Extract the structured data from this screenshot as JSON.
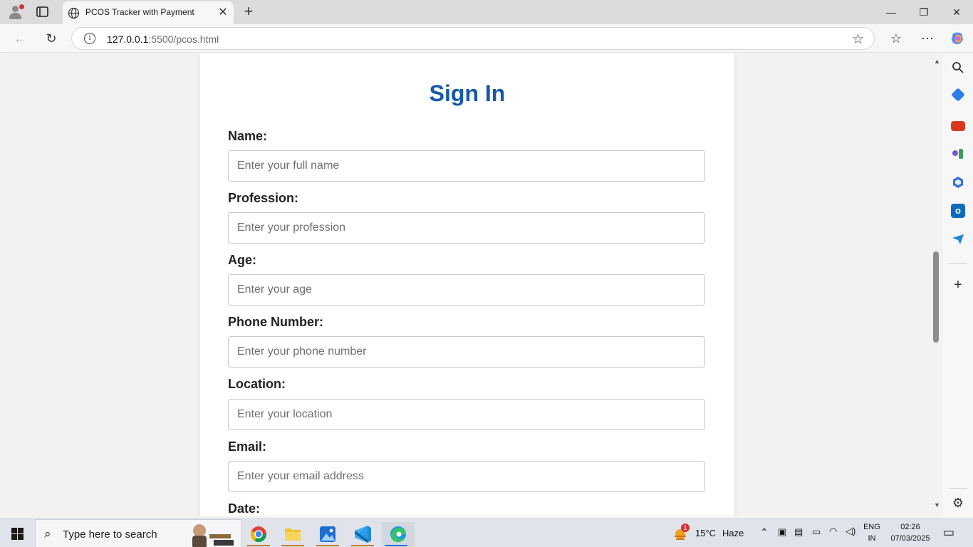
{
  "browser": {
    "tab_title": "PCOS Tracker with Payment",
    "url_host": "127.0.0.1",
    "url_path": ":5500/pcos.html"
  },
  "form": {
    "heading": "Sign In",
    "fields": [
      {
        "label": "Name:",
        "placeholder": "Enter your full name"
      },
      {
        "label": "Profession:",
        "placeholder": "Enter your profession"
      },
      {
        "label": "Age:",
        "placeholder": "Enter your age"
      },
      {
        "label": "Phone Number:",
        "placeholder": "Enter your phone number"
      },
      {
        "label": "Location:",
        "placeholder": "Enter your location"
      },
      {
        "label": "Email:",
        "placeholder": "Enter your email address"
      },
      {
        "label": "Date:"
      }
    ]
  },
  "taskbar": {
    "search_placeholder": "Type here to search",
    "weather_temp": "15°C",
    "weather_desc": "Haze",
    "weather_badge": "1",
    "lang_top": "ENG",
    "lang_bottom": "IN",
    "time": "02:26",
    "date": "07/03/2025"
  },
  "colors": {
    "heading": "#1559a8",
    "accent_edge": "#2a6fd6"
  }
}
